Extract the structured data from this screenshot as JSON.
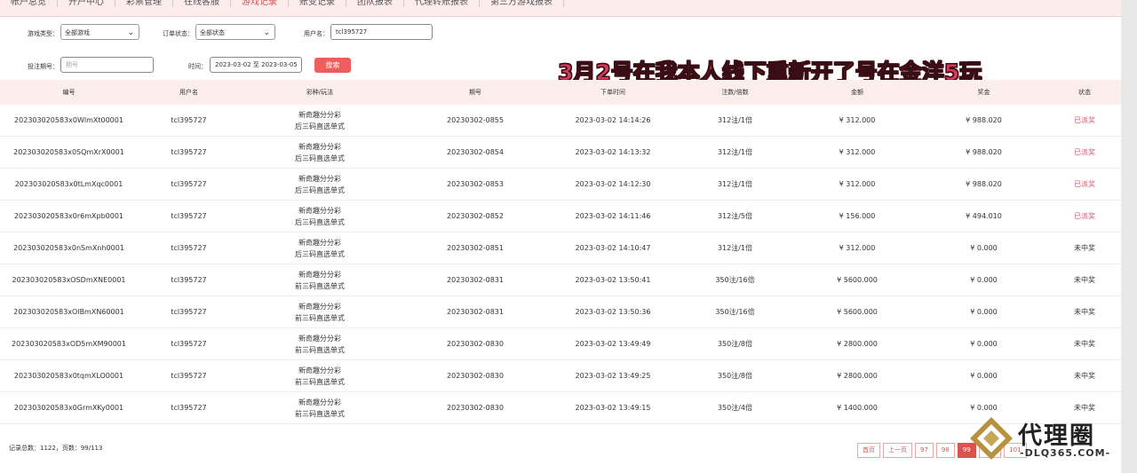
{
  "nav": {
    "items": [
      "帐户总览",
      "开户中心",
      "彩票管理",
      "在线客服",
      "游戏记录",
      "账变记录",
      "团队报表",
      "代理转账报表",
      "第三方游戏报表"
    ],
    "active_index": 4
  },
  "filters": {
    "game_type_label": "游戏类型：",
    "game_type_value": "全部游戏",
    "order_status_label": "订单状态：",
    "order_status_value": "全部状态",
    "username_label": "用户名：",
    "username_value": "tcl395727",
    "issue_label": "投注期号：",
    "issue_placeholder": "期号",
    "time_label": "时间：",
    "time_value": "2023-03-02 至 2023-03-05",
    "search_button": "搜索"
  },
  "overlay_caption": "3月2号在我本人线下重新开了号在金洋5玩",
  "table": {
    "headers": [
      "编号",
      "用户名",
      "彩种/玩法",
      "期号",
      "下单时间",
      "注数/倍数",
      "金额",
      "奖金",
      "状态"
    ],
    "rows": [
      {
        "id": "202303020583x0WlmXt00001",
        "user": "tcl395727",
        "game": "新奇趣分分彩",
        "play": "后三码直选单式",
        "issue": "20230302-0855",
        "time": "2023-03-02 14:14:26",
        "bets": "312注/1倍",
        "amount": "¥ 312.000",
        "prize": "¥ 988.020",
        "status": "已派奖",
        "won": true
      },
      {
        "id": "202303020583x0SQmXrX0001",
        "user": "tcl395727",
        "game": "新奇趣分分彩",
        "play": "后三码直选单式",
        "issue": "20230302-0854",
        "time": "2023-03-02 14:13:32",
        "bets": "312注/1倍",
        "amount": "¥ 312.000",
        "prize": "¥ 988.020",
        "status": "已派奖",
        "won": true
      },
      {
        "id": "202303020583x0tLmXqc0001",
        "user": "tcl395727",
        "game": "新奇趣分分彩",
        "play": "后三码直选单式",
        "issue": "20230302-0853",
        "time": "2023-03-02 14:12:30",
        "bets": "312注/1倍",
        "amount": "¥ 312.000",
        "prize": "¥ 988.020",
        "status": "已派奖",
        "won": true
      },
      {
        "id": "202303020583x0r6mXpb0001",
        "user": "tcl395727",
        "game": "新奇趣分分彩",
        "play": "后三码直选单式",
        "issue": "20230302-0852",
        "time": "2023-03-02 14:11:46",
        "bets": "312注/5倍",
        "amount": "¥ 156.000",
        "prize": "¥ 494.010",
        "status": "已派奖",
        "won": true
      },
      {
        "id": "202303020583x0nSmXnh0001",
        "user": "tcl395727",
        "game": "新奇趣分分彩",
        "play": "后三码直选单式",
        "issue": "20230302-0851",
        "time": "2023-03-02 14:10:47",
        "bets": "312注/1倍",
        "amount": "¥ 312.000",
        "prize": "¥ 0.000",
        "status": "未中奖",
        "won": false
      },
      {
        "id": "202303020583xOSDmXNE0001",
        "user": "tcl395727",
        "game": "新奇趣分分彩",
        "play": "前三码直选单式",
        "issue": "20230302-0831",
        "time": "2023-03-02 13:50:41",
        "bets": "350注/16倍",
        "amount": "¥ 5600.000",
        "prize": "¥ 0.000",
        "status": "未中奖",
        "won": false
      },
      {
        "id": "202303020583xOlBmXN60001",
        "user": "tcl395727",
        "game": "新奇趣分分彩",
        "play": "前三码直选单式",
        "issue": "20230302-0831",
        "time": "2023-03-02 13:50:36",
        "bets": "350注/16倍",
        "amount": "¥ 5600.000",
        "prize": "¥ 0.000",
        "status": "未中奖",
        "won": false
      },
      {
        "id": "202303020583xOD5mXM90001",
        "user": "tcl395727",
        "game": "新奇趣分分彩",
        "play": "前三码直选单式",
        "issue": "20230302-0830",
        "time": "2023-03-02 13:49:49",
        "bets": "350注/8倍",
        "amount": "¥ 2800.000",
        "prize": "¥ 0.000",
        "status": "未中奖",
        "won": false
      },
      {
        "id": "202303020583x0tqmXLO0001",
        "user": "tcl395727",
        "game": "新奇趣分分彩",
        "play": "前三码直选单式",
        "issue": "20230302-0830",
        "time": "2023-03-02 13:49:25",
        "bets": "350注/8倍",
        "amount": "¥ 2800.000",
        "prize": "¥ 0.000",
        "status": "未中奖",
        "won": false
      },
      {
        "id": "202303020583x0GrmXKy0001",
        "user": "tcl395727",
        "game": "新奇趣分分彩",
        "play": "前三码直选单式",
        "issue": "20230302-0830",
        "time": "2023-03-02 13:49:15",
        "bets": "350注/4倍",
        "amount": "¥ 1400.000",
        "prize": "¥ 0.000",
        "status": "未中奖",
        "won": false
      }
    ]
  },
  "footer": {
    "summary": "记录总数：1122，页数：99/113"
  },
  "pagination": {
    "first": "首页",
    "prev": "上一页",
    "pages": [
      "97",
      "98",
      "99",
      "100",
      "101"
    ],
    "current": "99"
  },
  "watermark": {
    "brand": "代理圈",
    "domain": "-DLQ365.COM-"
  },
  "colors": {
    "accent": "#d9534f",
    "header_bg": "#fdeeee",
    "search_button": "#ef5d5d",
    "won_status": "#e0556b",
    "overlay_text": "#d73a5c"
  }
}
